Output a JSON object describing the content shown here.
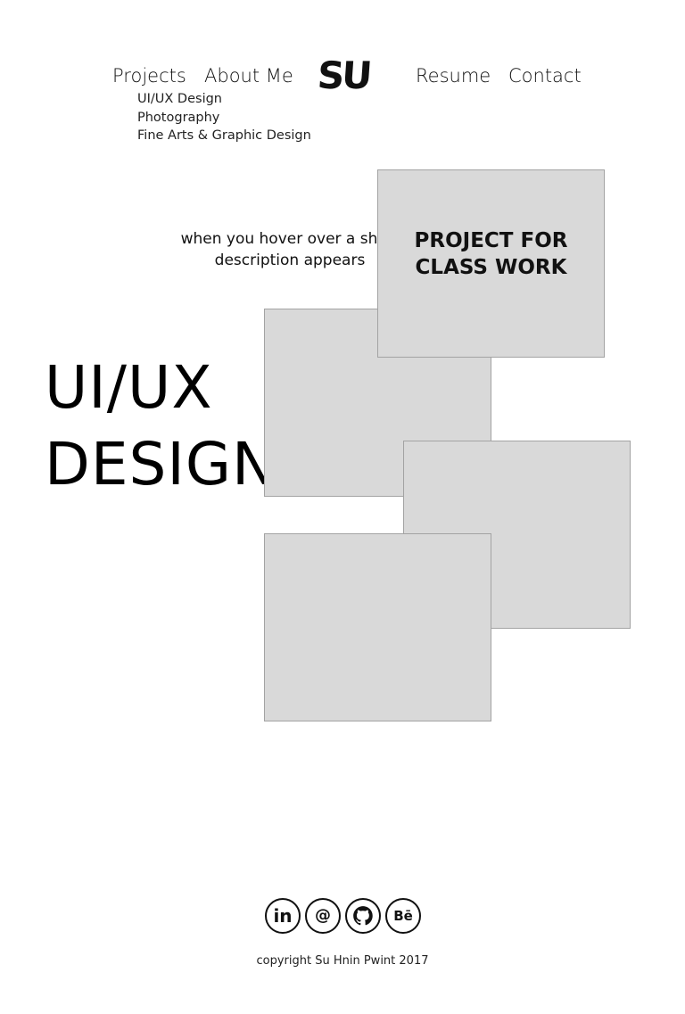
{
  "nav": {
    "projects": "Projects",
    "about": "About Me",
    "logo": "SU",
    "resume": "Resume",
    "contact": "Contact",
    "submenu": [
      "UI/UX Design",
      "Photography",
      "Fine Arts & Graphic Design"
    ]
  },
  "hover_description": "when you hover over a short description appears",
  "section": {
    "title_line1": "UI/UX",
    "title_line2": "DESIGN"
  },
  "tiles": [
    {
      "caption_line1": "PROJECT FOR",
      "caption_line2": "CLASS WORK"
    }
  ],
  "social": [
    {
      "icon": "linkedin-icon",
      "glyph": "in"
    },
    {
      "icon": "email-icon",
      "glyph": "@"
    },
    {
      "icon": "github-icon",
      "glyph": ""
    },
    {
      "icon": "behance-icon",
      "glyph": "Bē"
    }
  ],
  "footer": {
    "copyright": "copyright Su  Hnin  Pwint 2017"
  },
  "colors": {
    "tile_fill": "#d9d9d9",
    "tile_border": "#a3a3a3",
    "text": "#111111"
  }
}
